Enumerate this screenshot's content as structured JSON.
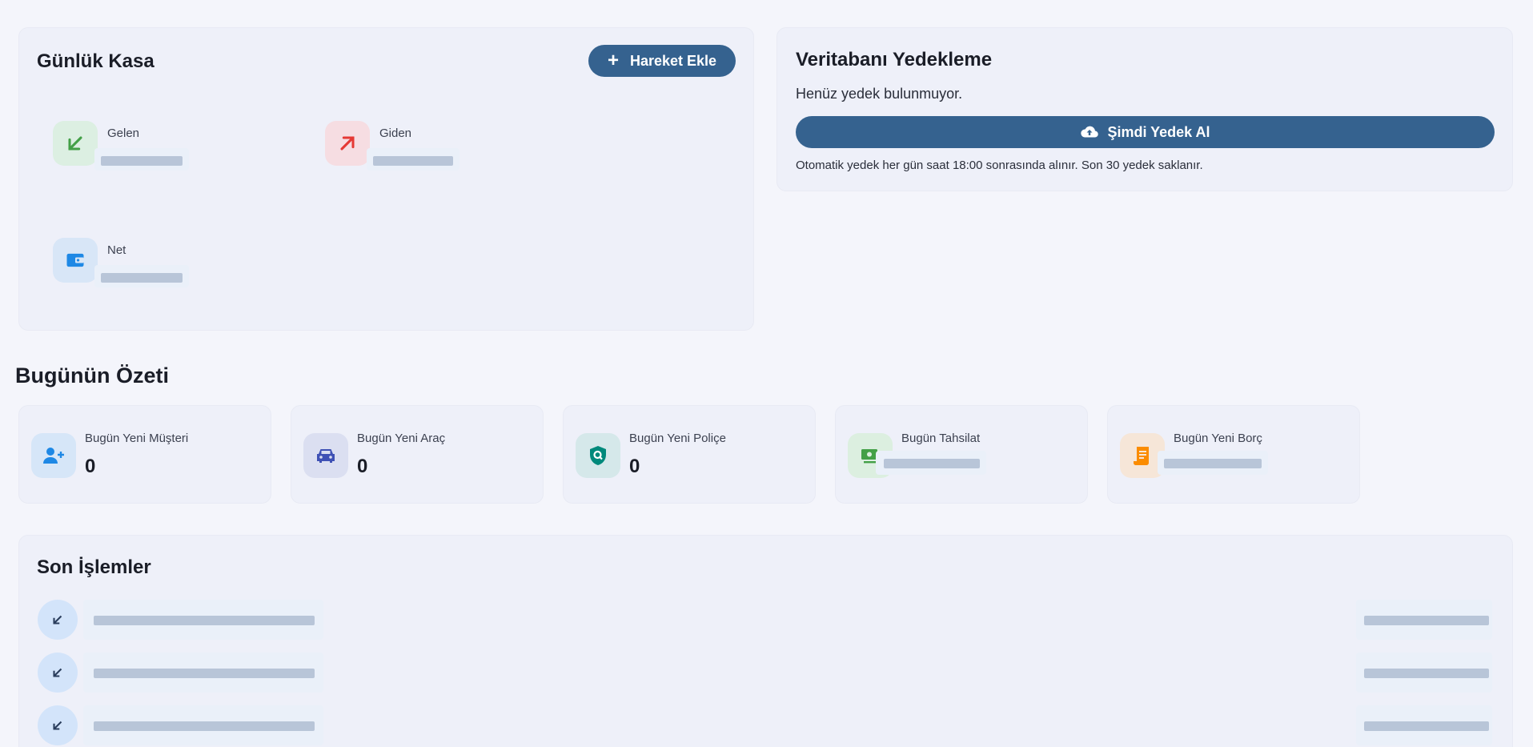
{
  "kasa": {
    "title": "Günlük Kasa",
    "add_button": "Hareket Ekle",
    "add_icon": "plus-icon",
    "stats": [
      {
        "label": "Gelen",
        "icon": "arrow-down-left-icon",
        "color": "#43a047",
        "bg": "#dcefe2"
      },
      {
        "label": "Giden",
        "icon": "arrow-up-right-icon",
        "color": "#e53935",
        "bg": "#f6dde2"
      },
      {
        "label": "Net",
        "icon": "wallet-icon",
        "color": "#1e88e5",
        "bg": "#d8e6f7"
      }
    ]
  },
  "backup": {
    "title": "Veritabanı Yedekleme",
    "status": "Henüz yedek bulunmuyor.",
    "button": "Şimdi Yedek Al",
    "button_icon": "cloud-upload-icon",
    "note": "Otomatik yedek her gün saat 18:00 sonrasında alınır. Son 30 yedek saklanır."
  },
  "summary": {
    "title": "Bugünün Özeti",
    "cards": [
      {
        "label": "Bugün Yeni Müşteri",
        "value": "0",
        "icon": "person-add-icon",
        "color": "#1e88e5",
        "bg": "#d6e6f8"
      },
      {
        "label": "Bugün Yeni Araç",
        "value": "0",
        "icon": "car-icon",
        "color": "#3f51b5",
        "bg": "#dbdff1"
      },
      {
        "label": "Bugün Yeni Poliçe",
        "value": "0",
        "icon": "shield-search-icon",
        "color": "#00897b",
        "bg": "#d5e8ea"
      },
      {
        "label": "Bugün Tahsilat",
        "value": null,
        "icon": "money-icon",
        "color": "#43a047",
        "bg": "#dcefe0"
      },
      {
        "label": "Bugün Yeni Borç",
        "value": null,
        "icon": "receipt-icon",
        "color": "#fb8c00",
        "bg": "#f6e6d8"
      }
    ]
  },
  "recent": {
    "title": "Son İşlemler",
    "row_icon": "arrow-down-left-icon",
    "row_color": "#2a3d5c",
    "row_count": 3
  },
  "colors": {
    "primary": "#35628f",
    "skeleton": "#b8c5d8",
    "page_bg": "#f4f5fb",
    "card_bg": "#eef0f9"
  }
}
